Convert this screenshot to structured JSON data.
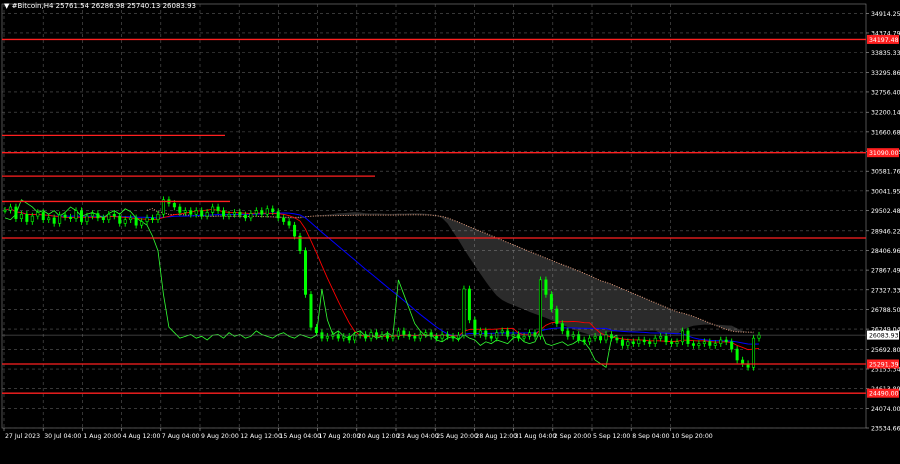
{
  "symbol_info": {
    "symbol": "#Bitcoin,H4",
    "open": "25761.54",
    "high": "26286.98",
    "low": "25740.13",
    "close": "26083.93"
  },
  "colors": {
    "background": "#000000",
    "grid": "#5a5a5a",
    "candles": "#00ff00",
    "level_lines": "#ff2020",
    "kijun": "#0000ff",
    "tenkan": "#ff0000",
    "chikou": "#33ff33",
    "senkou_b": "#e8a080",
    "cloud": "#f0f0f0",
    "price_tag": "#ffffff"
  },
  "chart_data": {
    "type": "candlestick",
    "ylim": [
      23534.66,
      35060
    ],
    "y_tick_labels": [
      "34914.25",
      "34374.79",
      "33835.33",
      "33295.86",
      "32756.40",
      "32200.14",
      "31660.68",
      "31121.22",
      "30581.76",
      "30041.95",
      "29502.48",
      "28946.22",
      "28406.96",
      "27867.49",
      "27327.33",
      "26788.50",
      "26249.04",
      "25692.80",
      "25153.34",
      "24613.89",
      "24074.00",
      "23534.66"
    ],
    "x_tick_labels": [
      "27 Jul 2023",
      "30 Jul 04:00",
      "1 Aug 20:00",
      "4 Aug 12:00",
      "7 Aug 04:00",
      "9 Aug 20:00",
      "12 Aug 12:00",
      "15 Aug 04:00",
      "17 Aug 20:00",
      "20 Aug 12:00",
      "23 Aug 04:00",
      "25 Aug 20:00",
      "28 Aug 12:00",
      "31 Aug 04:00",
      "2 Sep 20:00",
      "5 Sep 12:00",
      "8 Sep 04:00",
      "10 Sep 20:00"
    ],
    "horizontal_levels": [
      {
        "price": 34197.48,
        "label": "34197.48",
        "full": true
      },
      {
        "price": 31564.24,
        "full": false
      },
      {
        "price": 31090.0,
        "label": "31090.00",
        "full": true
      },
      {
        "price": 30447.0,
        "full": false
      },
      {
        "price": 29752.0,
        "full": false
      },
      {
        "price": 28748.0,
        "full": true
      },
      {
        "price": 25291.39,
        "label": "25291.39",
        "full": true
      },
      {
        "price": 24490.0,
        "label": "24490.00",
        "full": true
      }
    ],
    "current_price": "26083.93",
    "close_series": [
      29510,
      29600,
      29280,
      29400,
      29200,
      29350,
      29450,
      29250,
      29300,
      29150,
      29380,
      29320,
      29280,
      29500,
      29200,
      29350,
      29420,
      29300,
      29250,
      29400,
      29350,
      29150,
      29250,
      29300,
      29100,
      29200,
      29300,
      29250,
      29400,
      29800,
      29700,
      29600,
      29450,
      29500,
      29400,
      29500,
      29350,
      29450,
      29600,
      29500,
      29350,
      29400,
      29450,
      29380,
      29300,
      29420,
      29500,
      29400,
      29550,
      29470,
      29300,
      29200,
      29100,
      28800,
      28400,
      27200,
      26300,
      26150,
      26000,
      26050,
      26100,
      26000,
      26050,
      25950,
      26080,
      26100,
      26000,
      26150,
      26050,
      26100,
      26000,
      26050,
      26200,
      26100,
      26050,
      26000,
      26100,
      26150,
      26050,
      26000,
      26100,
      26050,
      26000,
      26080,
      27350,
      26500,
      26100,
      26200,
      26050,
      26000,
      26150,
      26200,
      26050,
      26100,
      26000,
      26050,
      26150,
      26050,
      27600,
      27200,
      26800,
      26400,
      26200,
      26050,
      26100,
      25950,
      25900,
      26000,
      26050,
      25950,
      26100,
      26000,
      25950,
      25800,
      25900,
      25850,
      25950,
      25900,
      25850,
      26000,
      26050,
      25900,
      25850,
      25900,
      26200,
      25850,
      25800,
      25850,
      25900,
      25800,
      25850,
      25950,
      25900,
      25700,
      25400,
      25300,
      25200,
      26000,
      26083.93
    ]
  }
}
